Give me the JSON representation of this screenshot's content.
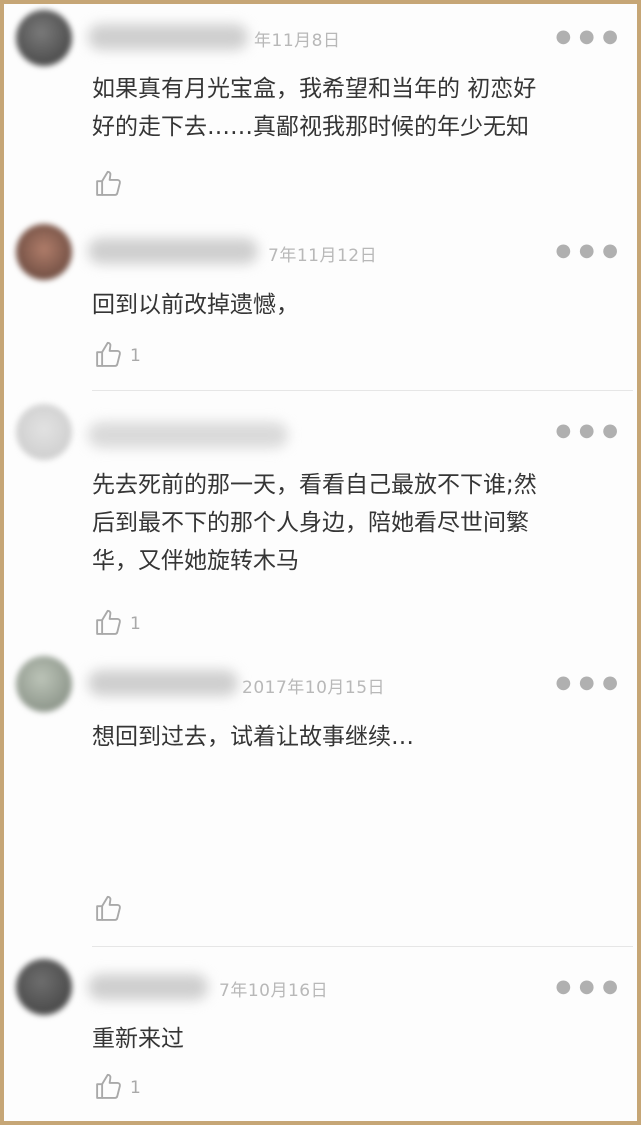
{
  "comments": [
    {
      "date": "年11月8日",
      "text": "如果真有月光宝盒，我希望和当年的 初恋好\n好的走下去……真鄙视我那时候的年少无知",
      "likes": ""
    },
    {
      "date": "7年11月12日",
      "text": "回到以前改掉遗憾，",
      "likes": "1"
    },
    {
      "date": "",
      "text": "先去死前的那一天，看看自己最放不下谁;然\n后到最不下的那个人身边，陪她看尽世间繁\n华，又伴她旋转木马",
      "likes": "1"
    },
    {
      "date": "2017年10月15日",
      "text": "想回到过去，试着让故事继续…",
      "likes": ""
    },
    {
      "date": "7年10月16日",
      "text": "重新来过",
      "likes": "1"
    }
  ],
  "icons": {
    "like": "thumbs-up-icon",
    "more": "more-icon"
  },
  "colors": {
    "frame": "#c6a676",
    "text": "#353535",
    "meta": "#b8b8b8"
  }
}
